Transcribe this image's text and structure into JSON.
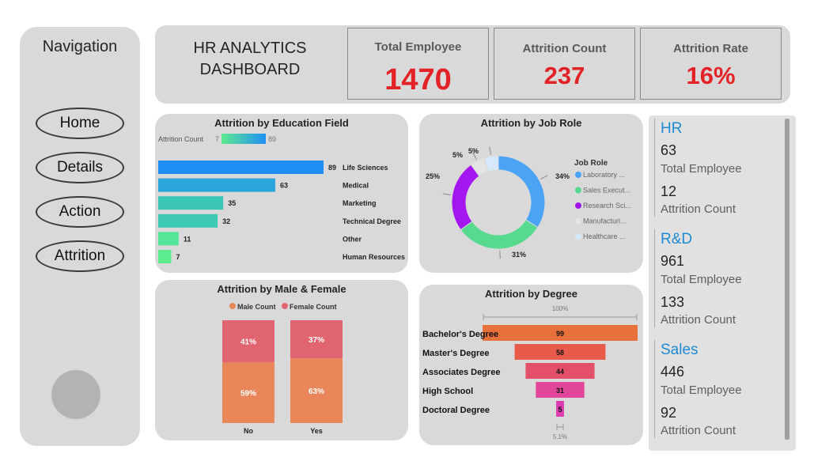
{
  "nav": {
    "title": "Navigation",
    "buttons": [
      "Home",
      "Details",
      "Action",
      "Attrition"
    ]
  },
  "header": {
    "title_line1": "HR ANALYTICS",
    "title_line2": "DASHBOARD",
    "kpis": [
      {
        "label": "Total Employee",
        "value": "1470"
      },
      {
        "label": "Attrition Count",
        "value": "237"
      },
      {
        "label": "Attrition Rate",
        "value": "16%"
      }
    ]
  },
  "chart_data": [
    {
      "type": "bar",
      "title": "Attrition by Education Field",
      "legend_label": "Attrition Count",
      "legend_min": "7",
      "legend_max": "89",
      "categories": [
        "Life Sciences",
        "Medical",
        "Marketing",
        "Technical Degree",
        "Other",
        "Human Resources"
      ],
      "values": [
        89,
        63,
        35,
        32,
        11,
        7
      ],
      "colors": [
        "#1e8ff5",
        "#2aa6dc",
        "#3cc6b8",
        "#3ec9b2",
        "#55e69a",
        "#5deb8f"
      ]
    },
    {
      "type": "pie",
      "title": "Attrition by Job Role",
      "legend_title": "Job Role",
      "legend": [
        "Laboratory ...",
        "Sales Execut...",
        "Research Sci...",
        "Manufacturi...",
        "Healthcare ..."
      ],
      "slice_labels": [
        "34%",
        "31%",
        "25%",
        "5%",
        "5%"
      ],
      "values": [
        34,
        31,
        25,
        5,
        5
      ],
      "colors": [
        "#4aa3f5",
        "#57d98f",
        "#a316f0",
        "#e4e4e4",
        "#d6e8fa"
      ]
    },
    {
      "type": "bar",
      "title": "Attrition by Male & Female",
      "legend": [
        "Male Count",
        "Female Count"
      ],
      "legend_colors": [
        "#e9875a",
        "#e06570"
      ],
      "categories": [
        "No",
        "Yes"
      ],
      "series": [
        {
          "name": "Male Count",
          "values": [
            59,
            63
          ],
          "labels": [
            "59%",
            "63%"
          ]
        },
        {
          "name": "Female Count",
          "values": [
            41,
            37
          ],
          "labels": [
            "41%",
            "37%"
          ]
        }
      ]
    },
    {
      "type": "bar",
      "title": "Attrition by Degree",
      "top_label": "100%",
      "bottom_label": "5.1%",
      "categories": [
        "Bachelor's Degree",
        "Master's Degree",
        "Associates Degree",
        "High School",
        "Doctoral Degree"
      ],
      "values": [
        99,
        58,
        44,
        31,
        5
      ],
      "colors": [
        "#e8703a",
        "#e85a4a",
        "#e44f6a",
        "#e2469a",
        "#dd3db0"
      ]
    }
  ],
  "departments": [
    {
      "name": "HR",
      "total": "63",
      "total_label": "Total Employee",
      "attrition": "12",
      "attrition_label": "Attrition Count"
    },
    {
      "name": "R&D",
      "total": "961",
      "total_label": "Total Employee",
      "attrition": "133",
      "attrition_label": "Attrition Count"
    },
    {
      "name": "Sales",
      "total": "446",
      "total_label": "Total Employee",
      "attrition": "92",
      "attrition_label": "Attrition Count"
    }
  ]
}
